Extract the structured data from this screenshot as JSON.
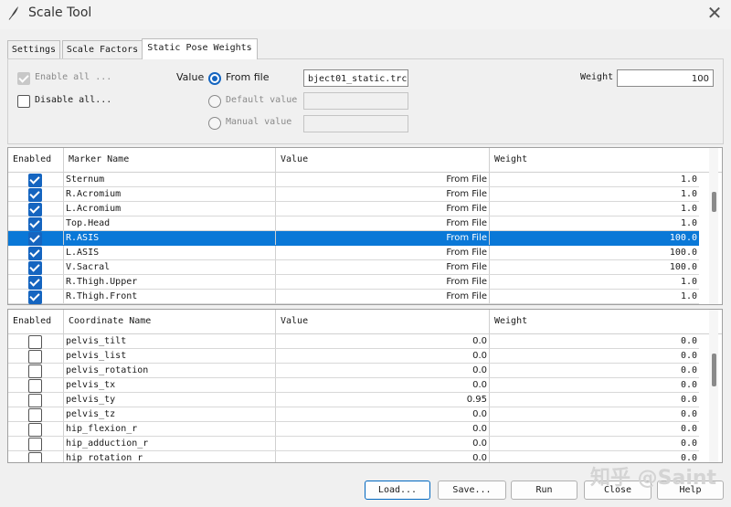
{
  "window": {
    "title": "Scale Tool",
    "icon": "feather-pen-icon",
    "close_icon": "close-icon"
  },
  "tabs": [
    {
      "label": "Settings",
      "active": false
    },
    {
      "label": "Scale Factors",
      "active": false
    },
    {
      "label": "Static Pose Weights",
      "active": true
    }
  ],
  "options": {
    "enable_all": "Enable all ...",
    "disable_all": "Disable all...",
    "value_label": "Value",
    "from_file": "From file",
    "default_value": "Default value",
    "manual_value": "Manual value",
    "file_value": "bject01_static.trc",
    "weight_label": "Weight",
    "weight_value": "100"
  },
  "marker_table": {
    "headers": [
      "Enabled",
      "Marker Name",
      "Value",
      "Weight"
    ],
    "rows": [
      {
        "name": "Sternum",
        "value": "From File",
        "weight": "1.0",
        "checked": true,
        "selected": false
      },
      {
        "name": "R.Acromium",
        "value": "From File",
        "weight": "1.0",
        "checked": true,
        "selected": false
      },
      {
        "name": "L.Acromium",
        "value": "From File",
        "weight": "1.0",
        "checked": true,
        "selected": false
      },
      {
        "name": "Top.Head",
        "value": "From File",
        "weight": "1.0",
        "checked": true,
        "selected": false
      },
      {
        "name": "R.ASIS",
        "value": "From File",
        "weight": "100.0",
        "checked": true,
        "selected": true
      },
      {
        "name": "L.ASIS",
        "value": "From File",
        "weight": "100.0",
        "checked": true,
        "selected": false
      },
      {
        "name": "V.Sacral",
        "value": "From File",
        "weight": "100.0",
        "checked": true,
        "selected": false
      },
      {
        "name": "R.Thigh.Upper",
        "value": "From File",
        "weight": "1.0",
        "checked": true,
        "selected": false
      },
      {
        "name": "R.Thigh.Front",
        "value": "From File",
        "weight": "1.0",
        "checked": true,
        "selected": false
      }
    ]
  },
  "coord_table": {
    "headers": [
      "Enabled",
      "Coordinate Name",
      "Value",
      "Weight"
    ],
    "rows": [
      {
        "name": "pelvis_tilt",
        "value": "0.0",
        "weight": "0.0",
        "checked": false
      },
      {
        "name": "pelvis_list",
        "value": "0.0",
        "weight": "0.0",
        "checked": false
      },
      {
        "name": "pelvis_rotation",
        "value": "0.0",
        "weight": "0.0",
        "checked": false
      },
      {
        "name": "pelvis_tx",
        "value": "0.0",
        "weight": "0.0",
        "checked": false
      },
      {
        "name": "pelvis_ty",
        "value": "0.95",
        "weight": "0.0",
        "checked": false
      },
      {
        "name": "pelvis_tz",
        "value": "0.0",
        "weight": "0.0",
        "checked": false
      },
      {
        "name": "hip_flexion_r",
        "value": "0.0",
        "weight": "0.0",
        "checked": false
      },
      {
        "name": "hip_adduction_r",
        "value": "0.0",
        "weight": "0.0",
        "checked": false
      },
      {
        "name": "hip_rotation_r",
        "value": "0.0",
        "weight": "0.0",
        "checked": false
      }
    ]
  },
  "buttons": {
    "load": "Load...",
    "save": "Save...",
    "run": "Run",
    "close": "Close",
    "help": "Help"
  },
  "watermark": "知乎 @Saint",
  "colors": {
    "selection": "#0a78d7",
    "checkbox": "#1565c0"
  }
}
